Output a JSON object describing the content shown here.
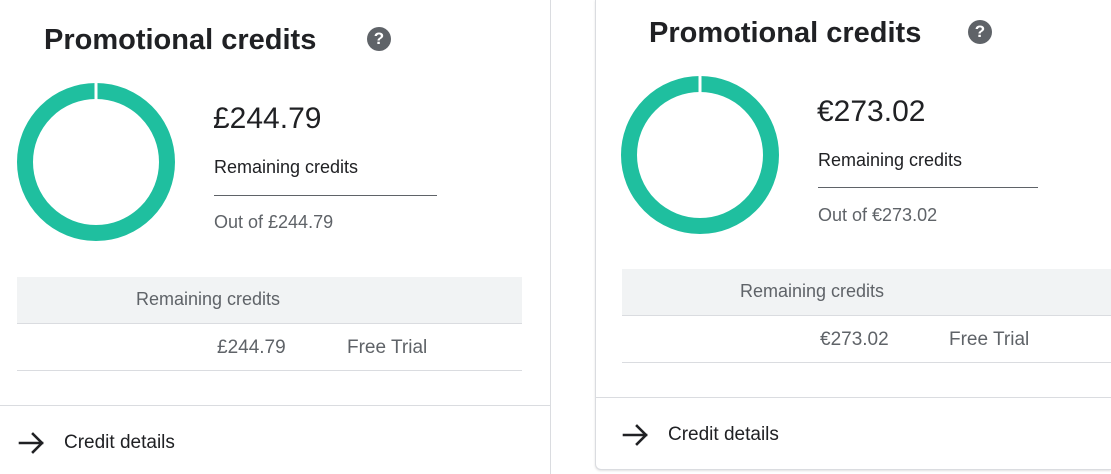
{
  "panels": [
    {
      "title": "Promotional credits",
      "help_icon": "help-circle-icon",
      "amount": "£244.79",
      "remaining_label": "Remaining credits",
      "out_of": "Out of £244.79",
      "remaining_fraction": 1.0,
      "table": {
        "header": "Remaining credits",
        "rows": [
          {
            "amount": "£244.79",
            "type": "Free Trial"
          }
        ]
      },
      "details_link": "Credit details"
    },
    {
      "title": "Promotional credits",
      "help_icon": "help-circle-icon",
      "amount": "€273.02",
      "remaining_label": "Remaining credits",
      "out_of": "Out of €273.02",
      "remaining_fraction": 1.0,
      "table": {
        "header": "Remaining credits",
        "rows": [
          {
            "amount": "€273.02",
            "type": "Free Trial"
          }
        ]
      },
      "details_link": "Credit details"
    }
  ],
  "colors": {
    "donut": "#1fbf9f",
    "donut_gap": "#ffffff",
    "text": "#202124",
    "muted": "#5f6368",
    "table_header_bg": "#f1f3f4"
  }
}
